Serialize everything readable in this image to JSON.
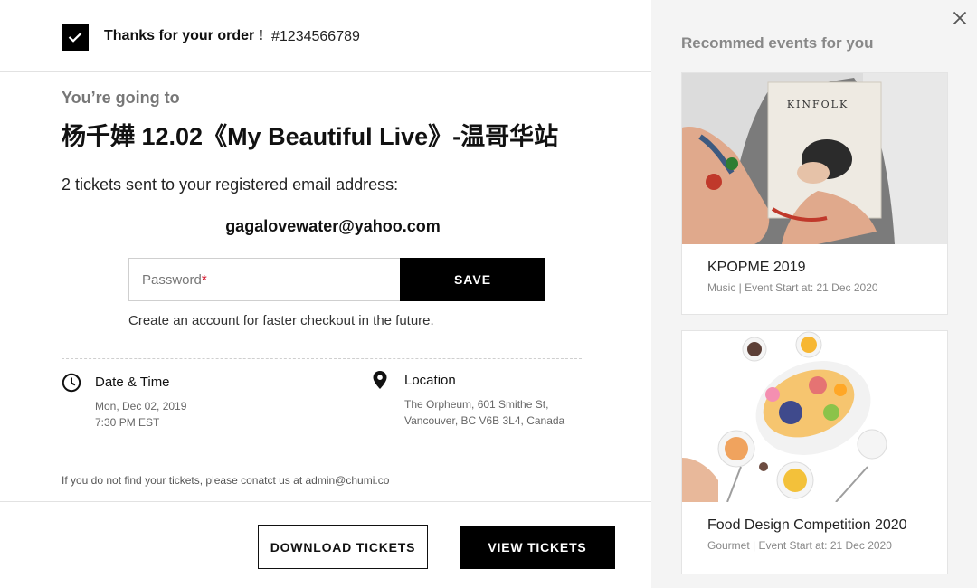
{
  "order": {
    "thanks_label": "Thanks for your order !",
    "number": "#1234566789"
  },
  "event": {
    "going_label": "You’re going to",
    "title": "杨千嬅 12.02《My Beautiful Live》-温哥华站",
    "tickets_sent": "2 tickets sent to your registered email address:",
    "email": "gagalovewater@yahoo.com"
  },
  "account": {
    "password_placeholder": "Password",
    "required_mark": "*",
    "save_label": "SAVE",
    "hint": "Create an account for faster checkout in the future."
  },
  "datetime": {
    "label": "Date & Time",
    "date": "Mon, Dec 02, 2019",
    "time": "7:30 PM EST"
  },
  "location": {
    "label": "Location",
    "line1": "The Orpheum, 601 Smithe St,",
    "line2": "Vancouver, BC V6B 3L4, Canada"
  },
  "help_text": "If you do not find your tickets, please conatct us at admin@chumi.co",
  "actions": {
    "download_label": "DOWNLOAD TICKETS",
    "view_label": "VIEW TICKETS"
  },
  "recommend": {
    "title": "Recommed events for you",
    "cards": [
      {
        "name": "KPOPME 2019",
        "meta": "Music  |  Event Start at: 21 Dec 2020",
        "image_text": "KINFOLK"
      },
      {
        "name": "Food Design Competition 2020",
        "meta": "Gourmet  |  Event Start at: 21 Dec 2020"
      }
    ]
  },
  "icons": {
    "check": "check-icon",
    "clock": "clock-icon",
    "location": "location-pin-icon",
    "close": "close-icon"
  },
  "colors": {
    "primary": "#000000",
    "required": "#d0021b",
    "sidebar_bg": "#f4f4f4",
    "muted": "#777777"
  }
}
